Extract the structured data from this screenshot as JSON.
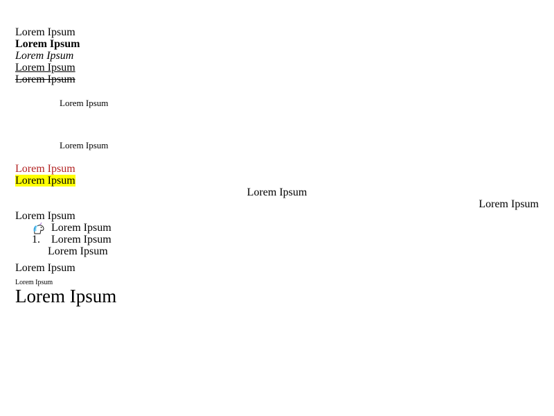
{
  "styles": {
    "colored_text_color": "#b22222",
    "highlight_color": "#ffff00"
  },
  "lines": {
    "plain": "Lorem Ipsum",
    "bold": "Lorem Ipsum",
    "italic": "Lorem Ipsum",
    "underline": "Lorem Ipsum",
    "strikethrough": "Lorem Ipsum",
    "small_indented_1": "Lorem Ipsum",
    "small_indented_2": "Lorem Ipsum",
    "colored": "Lorem Ipsum",
    "highlighted": "Lorem Ipsum",
    "centered": "Lorem Ipsum",
    "right_aligned": "Lorem Ipsum",
    "before_list": "Lorem Ipsum",
    "after_list": "Lorem Ipsum",
    "tiny": "Lorem Ipsum",
    "large": "Lorem Ipsum"
  },
  "list": {
    "items": [
      {
        "marker_icon": "unicorn-icon",
        "text": "Lorem Ipsum"
      },
      {
        "marker": "1.",
        "text": "Lorem Ipsum"
      }
    ],
    "continuation": "Lorem Ipsum"
  }
}
